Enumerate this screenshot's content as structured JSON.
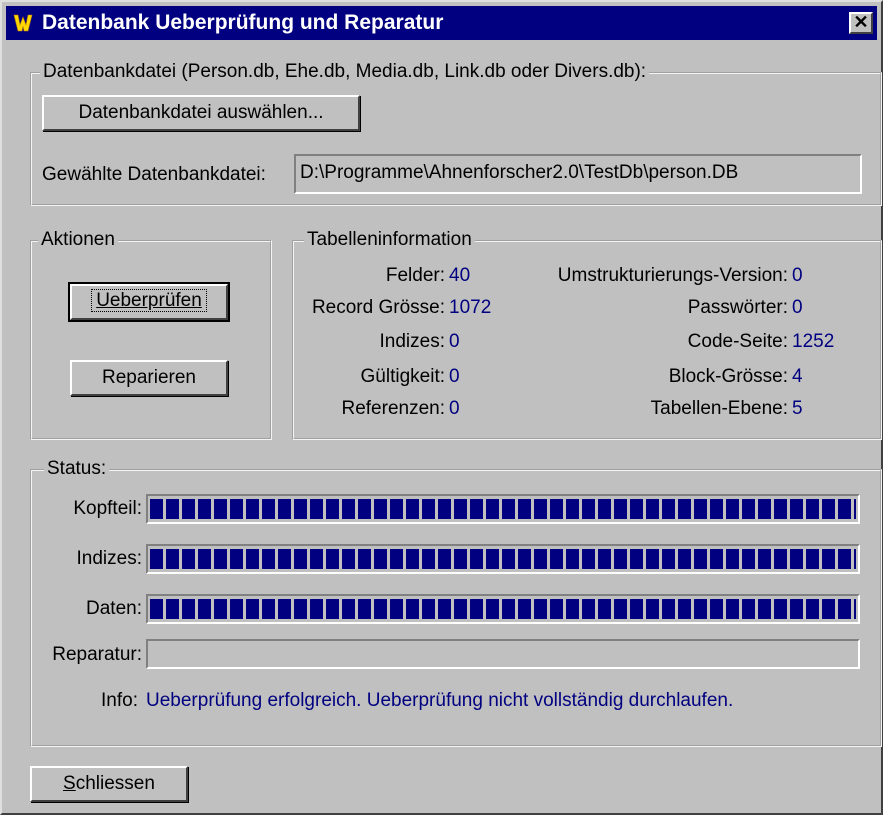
{
  "window": {
    "title": "Datenbank Ueberprüfung und Reparatur",
    "close_label": "✕"
  },
  "database": {
    "group_label": "Datenbankdatei (Person.db, Ehe.db, Media.db, Link.db oder Divers.db):",
    "select_button": "Datenbankdatei auswählen...",
    "selected_label": "Gewählte Datenbankdatei:",
    "selected_value": "D:\\Programme\\Ahnenforscher2.0\\TestDb\\person.DB"
  },
  "actions": {
    "group_label": "Aktionen",
    "check_button": "Ueberprüfen",
    "repair_button": "Reparieren"
  },
  "table_info": {
    "group_label": "Tabelleninformation",
    "left": [
      {
        "label": "Felder:",
        "value": "40"
      },
      {
        "label": "Record Grösse:",
        "value": "1072"
      },
      {
        "label": "Indizes:",
        "value": "0"
      },
      {
        "label": "Gültigkeit:",
        "value": "0"
      },
      {
        "label": "Referenzen:",
        "value": "0"
      }
    ],
    "right": [
      {
        "label": "Umstrukturierungs-Version:",
        "value": "0"
      },
      {
        "label": "Passwörter:",
        "value": "0"
      },
      {
        "label": "Code-Seite:",
        "value": "1252"
      },
      {
        "label": "Block-Grösse:",
        "value": "4"
      },
      {
        "label": "Tabellen-Ebene:",
        "value": "5"
      }
    ]
  },
  "status": {
    "group_label": "Status:",
    "bars": [
      {
        "label": "Kopfteil:",
        "progress": 1.0
      },
      {
        "label": "Indizes:",
        "progress": 1.0
      },
      {
        "label": "Daten:",
        "progress": 1.0
      },
      {
        "label": "Reparatur:",
        "progress": 0.0
      }
    ],
    "info_label": "Info:",
    "info_text": "Ueberprüfung erfolgreich. Ueberprüfung nicht vollständig durchlaufen."
  },
  "footer": {
    "close_button_first": "S",
    "close_button_rest": "chliessen"
  },
  "colors": {
    "title_bar": "#000080",
    "value_text": "#000080",
    "progress_fill": "#000080",
    "face": "#c0c0c0"
  }
}
